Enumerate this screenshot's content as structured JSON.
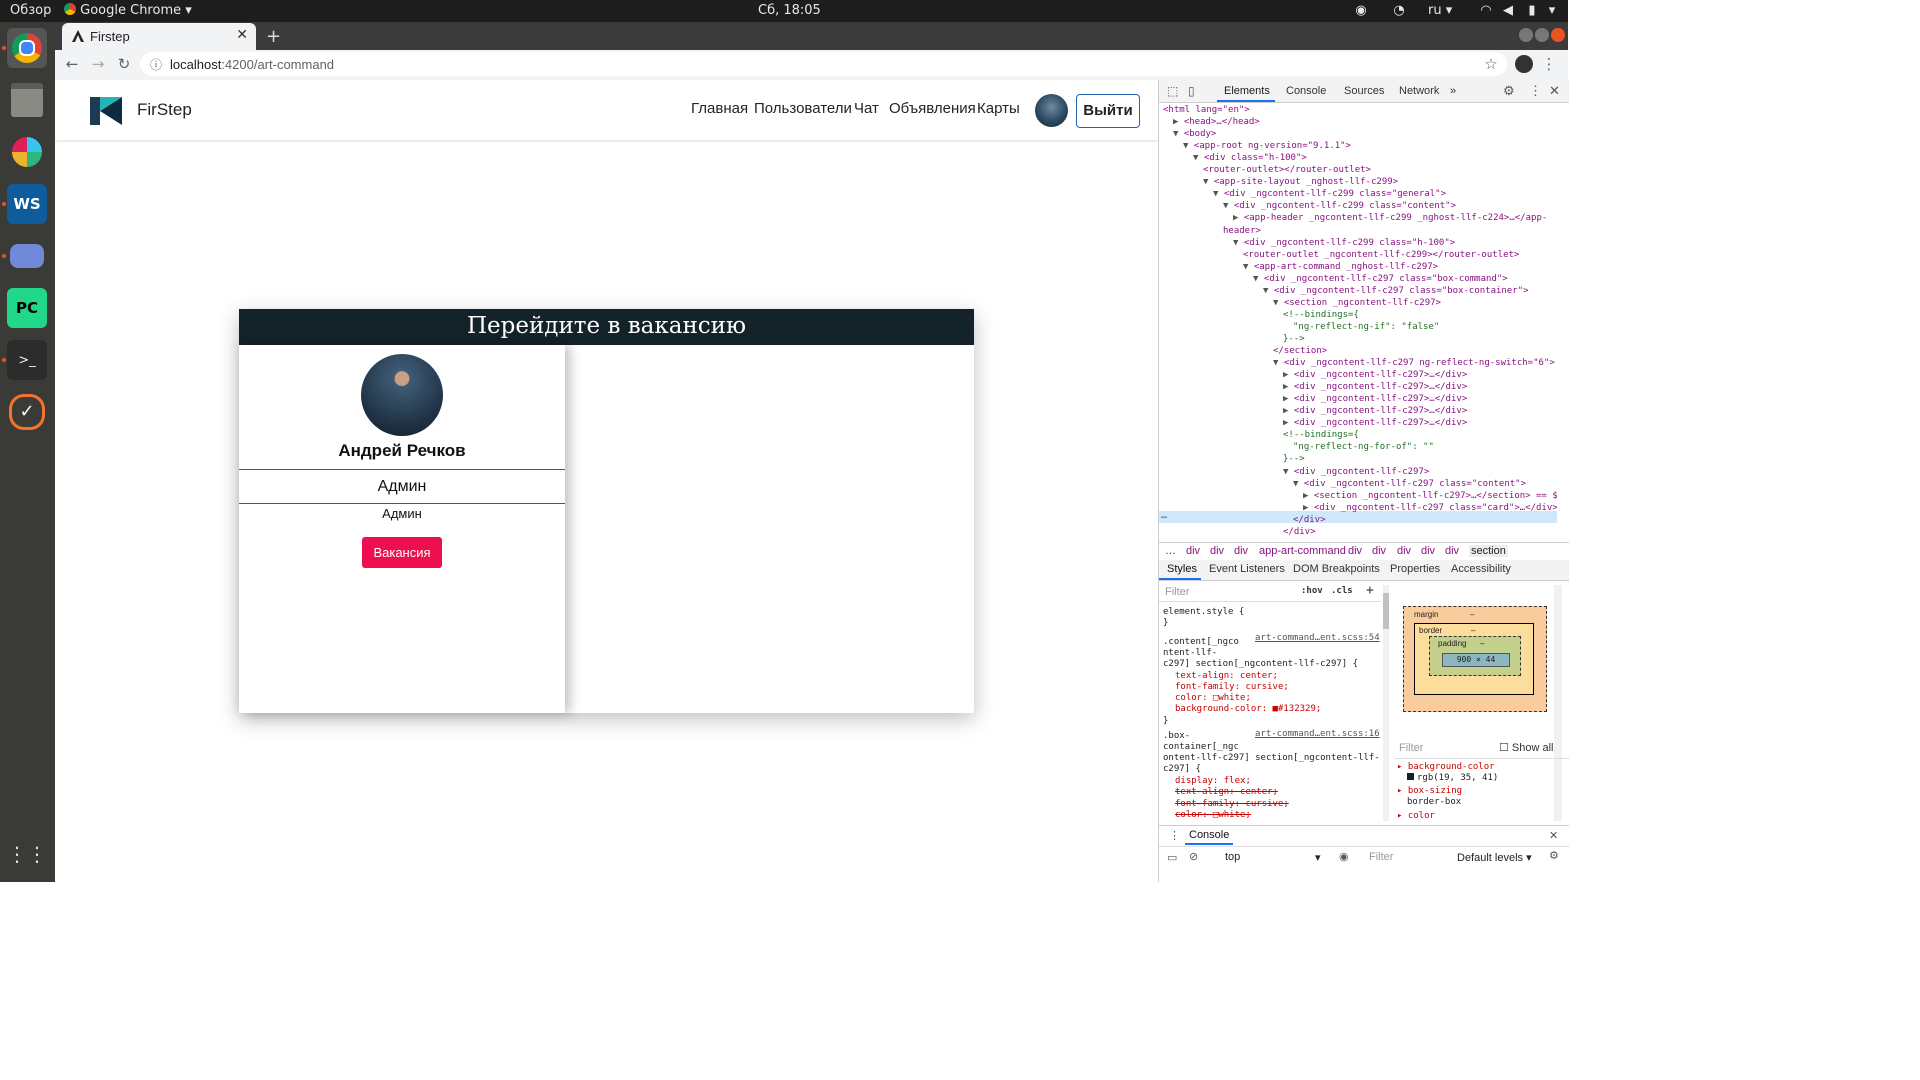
{
  "system": {
    "activities": "Обзор",
    "app_menu": "Google Chrome",
    "clock": "Сб, 18:05",
    "lang": "ru"
  },
  "browser": {
    "tab_title": "Firstep",
    "url_host": "localhost",
    "url_path": ":4200/art-command",
    "new_tab": "+"
  },
  "site": {
    "brand": "FirStep",
    "nav": [
      "Главная",
      "Пользователи",
      "Чат",
      "Объявления",
      "Карты"
    ],
    "logout": "Выйти"
  },
  "box": {
    "title": "Перейдите в вакансию",
    "card": {
      "name": "Андрей Речков",
      "role": "Админ",
      "role_sub": "Админ",
      "button": "Вакансия"
    }
  },
  "devtools": {
    "tabs": [
      "Elements",
      "Console",
      "Sources",
      "Network",
      "»"
    ],
    "dom_lines": [
      {
        "indent": 0,
        "tri": "",
        "tag": "<html lang=\"en\">"
      },
      {
        "indent": 1,
        "tri": "▶",
        "tag": "<head>…</head>"
      },
      {
        "indent": 1,
        "tri": "▼",
        "tag": "<body>"
      },
      {
        "indent": 2,
        "tri": "▼",
        "tag": "<app-root ng-version=\"9.1.1\">"
      },
      {
        "indent": 3,
        "tri": "▼",
        "tag": "<div class=\"h-100\">"
      },
      {
        "indent": 4,
        "tri": "",
        "tag": "<router-outlet></router-outlet>"
      },
      {
        "indent": 4,
        "tri": "▼",
        "tag": "<app-site-layout _nghost-llf-c299>"
      },
      {
        "indent": 5,
        "tri": "▼",
        "tag": "<div _ngcontent-llf-c299 class=\"general\">"
      },
      {
        "indent": 6,
        "tri": "▼",
        "tag": "<div _ngcontent-llf-c299 class=\"content\">"
      },
      {
        "indent": 7,
        "tri": "▶",
        "tag": "<app-header _ngcontent-llf-c299 _nghost-llf-c224>…</app-"
      },
      {
        "indent": 6,
        "tri": "",
        "tag": "header>"
      },
      {
        "indent": 7,
        "tri": "▼",
        "tag": "<div _ngcontent-llf-c299 class=\"h-100\">"
      },
      {
        "indent": 8,
        "tri": "",
        "tag": "<router-outlet _ngcontent-llf-c299></router-outlet>"
      },
      {
        "indent": 8,
        "tri": "▼",
        "tag": "<app-art-command _nghost-llf-c297>"
      },
      {
        "indent": 9,
        "tri": "▼",
        "tag": "<div _ngcontent-llf-c297 class=\"box-command\">"
      },
      {
        "indent": 10,
        "tri": "▼",
        "tag": "<div _ngcontent-llf-c297 class=\"box-container\">"
      },
      {
        "indent": 11,
        "tri": "▼",
        "tag": "<section _ngcontent-llf-c297>"
      },
      {
        "indent": 12,
        "tri": "",
        "tag": "<!--bindings={"
      },
      {
        "indent": 13,
        "tri": "",
        "tag": "\"ng-reflect-ng-if\": \"false\""
      },
      {
        "indent": 12,
        "tri": "",
        "tag": "}-->"
      },
      {
        "indent": 11,
        "tri": "",
        "tag": "</section>"
      },
      {
        "indent": 11,
        "tri": "▼",
        "tag": "<div _ngcontent-llf-c297 ng-reflect-ng-switch=\"6\">"
      },
      {
        "indent": 12,
        "tri": "▶",
        "tag": "<div _ngcontent-llf-c297>…</div>"
      },
      {
        "indent": 12,
        "tri": "▶",
        "tag": "<div _ngcontent-llf-c297>…</div>"
      },
      {
        "indent": 12,
        "tri": "▶",
        "tag": "<div _ngcontent-llf-c297>…</div>"
      },
      {
        "indent": 12,
        "tri": "▶",
        "tag": "<div _ngcontent-llf-c297>…</div>"
      },
      {
        "indent": 12,
        "tri": "▶",
        "tag": "<div _ngcontent-llf-c297>…</div>"
      },
      {
        "indent": 12,
        "tri": "",
        "tag": "<!--bindings={"
      },
      {
        "indent": 13,
        "tri": "",
        "tag": "\"ng-reflect-ng-for-of\": \"\""
      },
      {
        "indent": 12,
        "tri": "",
        "tag": "}-->"
      },
      {
        "indent": 12,
        "tri": "▼",
        "tag": "<div _ngcontent-llf-c297>"
      },
      {
        "indent": 13,
        "tri": "▼",
        "tag": "<div _ngcontent-llf-c297 class=\"content\">"
      },
      {
        "indent": 14,
        "tri": "▶",
        "tag": "<section _ngcontent-llf-c297>…</section> == $0"
      },
      {
        "indent": 14,
        "tri": "▶",
        "tag": "<div _ngcontent-llf-c297 class=\"card\">…</div>"
      },
      {
        "indent": 13,
        "tri": "",
        "tag": "</div>"
      },
      {
        "indent": 12,
        "tri": "",
        "tag": "</div>"
      }
    ],
    "breadcrumbs": [
      "…",
      "div",
      "div",
      "div",
      "app-art-command",
      "div",
      "div",
      "div",
      "div",
      "div",
      "section"
    ],
    "sub_tabs": [
      "Styles",
      "Event Listeners",
      "DOM Breakpoints",
      "Properties",
      "Accessibility"
    ],
    "filter_placeholder": "Filter",
    "hov": ":hov",
    "cls": ".cls",
    "styles_lines": [
      "element.style {",
      "}",
      ".content[_ngco",
      "ntent-llf-",
      "c297] section[_ngcontent-llf-c297] {",
      "text-align: center;",
      "font-family: cursive;",
      "color: □white;",
      "background-color: ■#132329;",
      "}",
      ".box-",
      "container[_ngc",
      "ontent-llf-c297] section[_ngcontent-llf-",
      "c297] {",
      "display: flex;",
      "text-align: center;",
      "font-family: cursive;",
      "color: □white;"
    ],
    "src_1": "art-command…ent.scss:54",
    "src_2": "art-command…ent.scss:16",
    "boxmodel": {
      "margin": "margin",
      "border": "border",
      "padding": "padding",
      "content": "900 × 44",
      "dash": "–"
    },
    "computed_filter": "Filter",
    "show_all": "Show all",
    "computed": [
      {
        "prop": "background-color",
        "val": "rgb(19, 35, 41)"
      },
      {
        "prop": "box-sizing",
        "val": "border-box"
      },
      {
        "prop": "color",
        "val": ""
      }
    ],
    "console_title": "Console",
    "console_context": "top",
    "console_filter": "Filter",
    "default_levels": "Default levels"
  }
}
